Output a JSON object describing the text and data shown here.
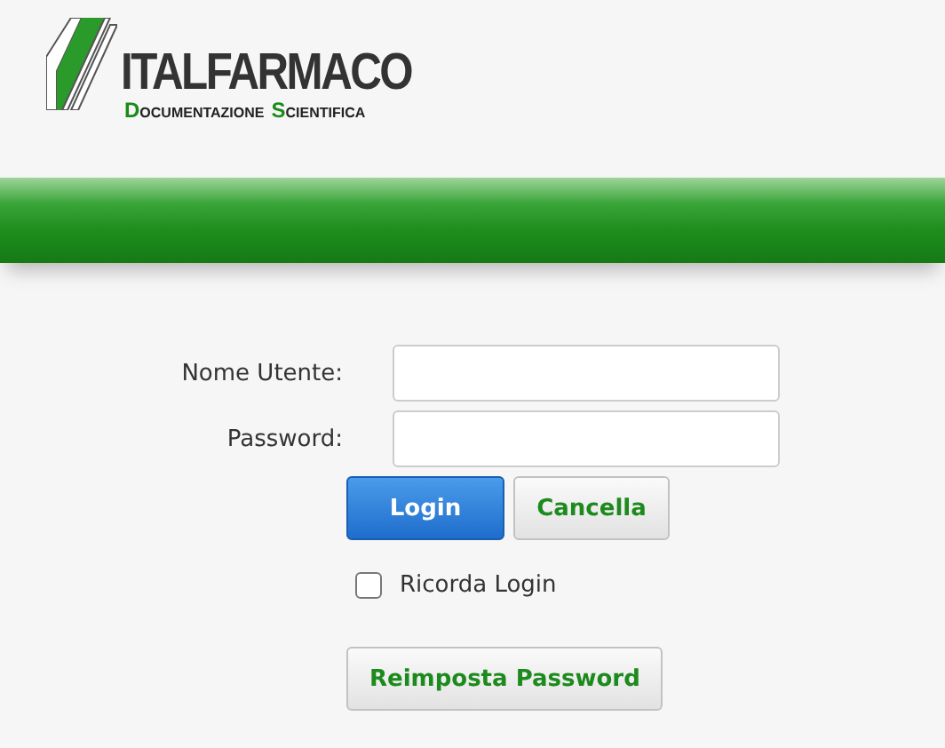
{
  "logo": {
    "name": "ITALFARMACO",
    "subtitle": [
      "DOCUMENTAZIONE",
      "SCIENTIFICA"
    ]
  },
  "form": {
    "fields": [
      {
        "label": "Nome Utente:"
      },
      {
        "label": "Password:"
      }
    ],
    "buttons": [
      {
        "label": "Login",
        "kind": "primary"
      },
      {
        "label": "Cancella",
        "kind": "secondary"
      }
    ],
    "remember": {
      "label": "Ricorda Login",
      "checked": false
    },
    "reset_button": "Reimposta Password"
  }
}
